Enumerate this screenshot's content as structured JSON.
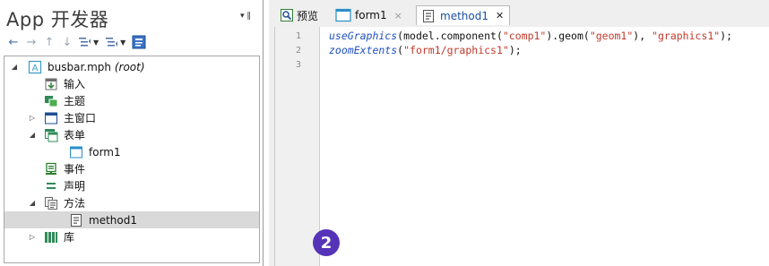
{
  "left": {
    "title": "App 开发器",
    "pin": "▾ ‖"
  },
  "tree": {
    "root": {
      "name": "busbar.mph",
      "note": "(root)"
    },
    "items": [
      {
        "label": "输入"
      },
      {
        "label": "主题"
      },
      {
        "label": "主窗口"
      },
      {
        "label": "表单"
      },
      {
        "label": "form1"
      },
      {
        "label": "事件"
      },
      {
        "label": "声明"
      },
      {
        "label": "方法"
      },
      {
        "label": "method1"
      },
      {
        "label": "库"
      }
    ]
  },
  "tabs": {
    "preview": {
      "label": "预览"
    },
    "form1": {
      "label": "form1",
      "close": "×"
    },
    "method1": {
      "label": "method1",
      "close": "✕"
    }
  },
  "editor": {
    "line_numbers": [
      "1",
      "2",
      "3"
    ],
    "lines": [
      {
        "fn": "useGraphics",
        "p1": "(model.component(",
        "s1": "\"comp1\"",
        "p2": ").geom(",
        "s2": "\"geom1\"",
        "p3": "), ",
        "s3": "\"graphics1\"",
        "p4": ");"
      },
      {
        "fn": "zoomExtents",
        "p1": "(",
        "s1": "\"form1/graphics1\"",
        "p2": ");"
      }
    ]
  },
  "badge": {
    "text": "2"
  },
  "colors": {
    "accent": "#5634b8",
    "keyword": "#1f50c0",
    "string": "#c0392b",
    "selection": "#d9d9d9"
  }
}
